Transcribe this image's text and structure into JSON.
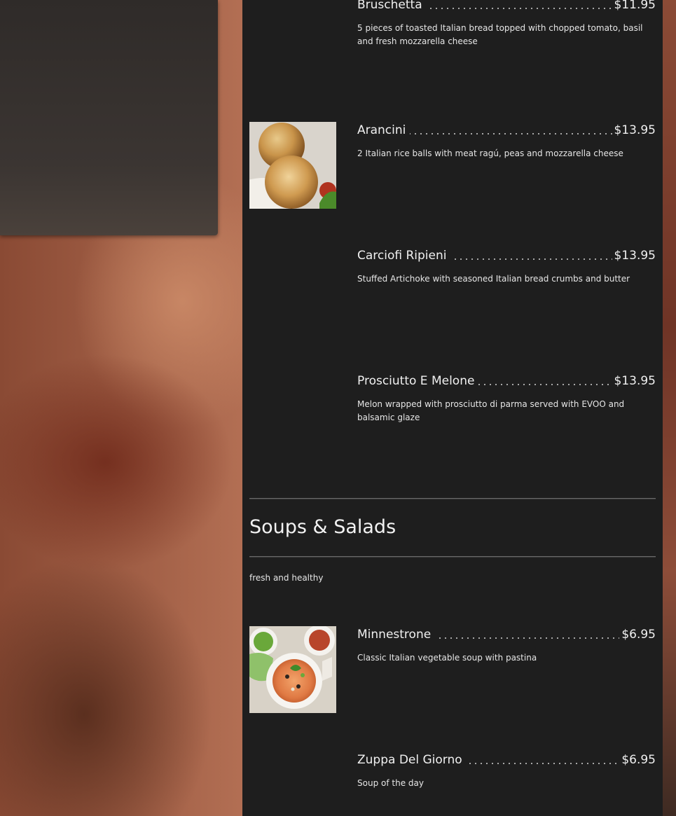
{
  "sections": [
    {
      "items": [
        {
          "name": "Bruschetta",
          "price": "$11.95",
          "description": "5 pieces of toasted Italian bread topped with chopped tomato, basil and fresh mozzarella cheese"
        },
        {
          "name": "Arancini",
          "price": "$13.95",
          "description": "2 Italian rice balls with meat ragú, peas and mozzarella cheese",
          "image": "arancini-photo"
        },
        {
          "name": "Carciofi Ripieni",
          "price": "$13.95",
          "description": "Stuffed Artichoke with seasoned Italian bread crumbs and butter"
        },
        {
          "name": "Prosciutto E Melone",
          "price": "$13.95",
          "description": "Melon wrapped with prosciutto di parma served with EVOO and balsamic glaze"
        }
      ]
    },
    {
      "title": "Soups & Salads",
      "subtitle": "fresh and healthy",
      "items": [
        {
          "name": "Minnestrone",
          "price": "$6.95",
          "description": "Classic Italian vegetable soup with pastina",
          "image": "minestrone-photo"
        },
        {
          "name": "Zuppa Del Giorno",
          "price": "$6.95",
          "description": "Soup of the day"
        }
      ]
    }
  ],
  "colors": {
    "panel": "#1e1e1e",
    "text": "#f0f0f0",
    "background": "#b77357"
  }
}
